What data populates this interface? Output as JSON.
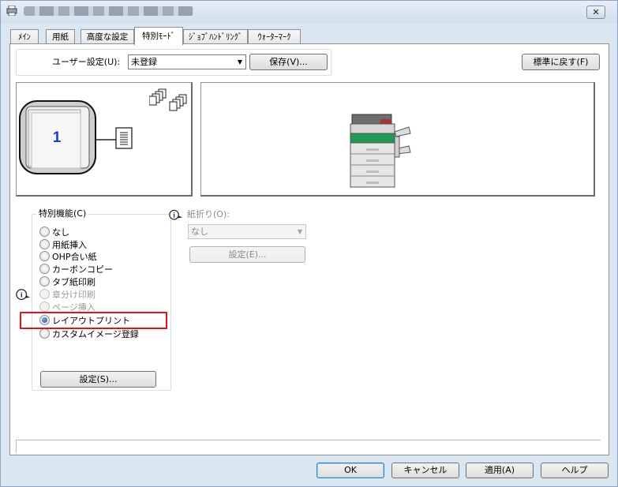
{
  "window": {
    "close_glyph": "✕"
  },
  "tabs": [
    {
      "label": "ﾒｲﾝ",
      "selected": false
    },
    {
      "label": "用紙",
      "selected": false
    },
    {
      "label": "高度な設定",
      "selected": false
    },
    {
      "label": "特別ﾓｰﾄﾞ",
      "selected": true
    },
    {
      "label": "ｼﾞｮﾌﾞﾊﾝﾄﾞﾘﾝｸﾞ",
      "selected": false
    },
    {
      "label": "ｳｫｰﾀｰﾏｰｸ",
      "selected": false
    }
  ],
  "user_settings": {
    "label": "ユーザー設定(U):",
    "value": "未登録",
    "save_label": "保存(V)...",
    "reset_label": "標準に戻す(F)"
  },
  "preview": {
    "page_number": "1"
  },
  "special_feature": {
    "legend": "特別機能(C)",
    "options": [
      {
        "label": "なし",
        "checked": false,
        "disabled": false
      },
      {
        "label": "用紙挿入",
        "checked": false,
        "disabled": false
      },
      {
        "label": "OHP合い紙",
        "checked": false,
        "disabled": false
      },
      {
        "label": "カーボンコピー",
        "checked": false,
        "disabled": false
      },
      {
        "label": "タブ紙印刷",
        "checked": false,
        "disabled": false
      },
      {
        "label": "章分け印刷",
        "checked": false,
        "disabled": true
      },
      {
        "label": "ページ挿入",
        "checked": false,
        "disabled": true
      },
      {
        "label": "レイアウトプリント",
        "checked": true,
        "disabled": false
      },
      {
        "label": "カスタムイメージ登録",
        "checked": false,
        "disabled": false
      }
    ],
    "settings_label": "設定(S)..."
  },
  "fold": {
    "label": "紙折り(O):",
    "value": "なし",
    "settings_label": "設定(E)..."
  },
  "footer": {
    "ok": "OK",
    "cancel": "キャンセル",
    "apply": "適用(A)",
    "help": "ヘルプ"
  },
  "colors": {
    "highlight_border": "#e0141c",
    "radio_selected": "#1f4f9a",
    "page_number": "#1a3ccf"
  }
}
